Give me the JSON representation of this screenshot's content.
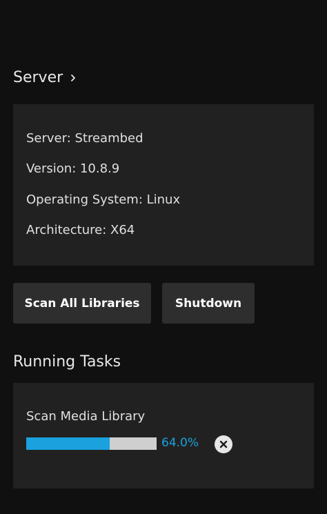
{
  "server_section": {
    "title": "Server",
    "info": {
      "server": "Server: Streambed",
      "version": "Version: 10.8.9",
      "os": "Operating System: Linux",
      "architecture": "Architecture: X64"
    }
  },
  "buttons": {
    "scan_all": "Scan All Libraries",
    "shutdown": "Shutdown"
  },
  "running_tasks": {
    "title": "Running Tasks",
    "tasks": [
      {
        "name": "Scan Media Library",
        "progress_percent": 64.0,
        "progress_label": "64.0%"
      }
    ]
  },
  "icons": {
    "header_chevron": "chevron-right-icon",
    "cancel": "close-icon"
  },
  "colors": {
    "background": "#101010",
    "card": "#212121",
    "button": "#2e2e2e",
    "accent": "#1aa1de",
    "track": "#cfcfcf"
  }
}
